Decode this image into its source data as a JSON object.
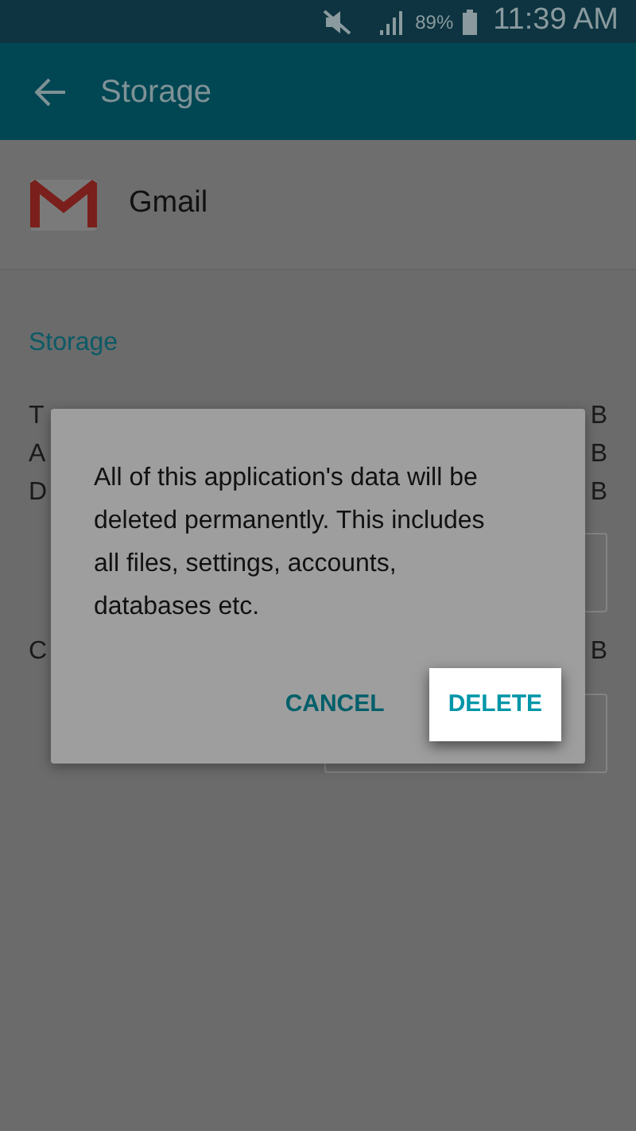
{
  "status_bar": {
    "battery": "89%",
    "time": "11:39 AM"
  },
  "app_bar": {
    "title": "Storage"
  },
  "app": {
    "name": "Gmail"
  },
  "section": {
    "title": "Storage"
  },
  "rows": [
    {
      "label": "T",
      "value": "B"
    },
    {
      "label": "A",
      "value": "B"
    },
    {
      "label": "D",
      "value": "B"
    }
  ],
  "cache_row": {
    "label": "C",
    "value": "B"
  },
  "dialog": {
    "message": "All of this application's data will be deleted permanently. This includes all files, settings, accounts, databases etc.",
    "buttons": [
      {
        "label": "CANCEL",
        "selected": false
      },
      {
        "label": "DELETE",
        "selected": true
      }
    ]
  }
}
